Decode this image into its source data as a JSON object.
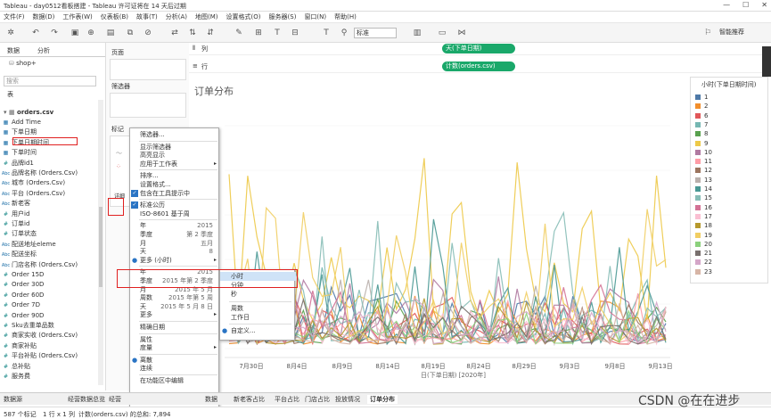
{
  "window": {
    "title": "Tableau - day0512看板搭建 - Tableau 许可证将在 14 天后过期",
    "buttons": [
      "—",
      "☐",
      "✕"
    ]
  },
  "menu": [
    "文件(F)",
    "数据(D)",
    "工作表(W)",
    "仪表板(B)",
    "故事(T)",
    "分析(A)",
    "地图(M)",
    "设置格式(O)",
    "服务器(S)",
    "窗口(N)",
    "帮助(H)"
  ],
  "toolbar": {
    "show_as": "标准",
    "smart": "智能推荐"
  },
  "sidebar": {
    "tab_data": "数据",
    "tab_analysis": "分析",
    "datasource": "shop+",
    "search_placeholder": "搜索",
    "table_header": "表",
    "table_name": "orders.csv",
    "fields": [
      {
        "icon": "dt",
        "name": "Add Time"
      },
      {
        "icon": "dt",
        "name": "下单日期"
      },
      {
        "icon": "dt",
        "name": "下单日期时间"
      },
      {
        "icon": "dt",
        "name": "下单时间"
      },
      {
        "icon": "#",
        "name": "品牌id1"
      },
      {
        "icon": "abc",
        "name": "品牌名称 (Orders.Csv)"
      },
      {
        "icon": "abc",
        "name": "城市 (Orders.Csv)"
      },
      {
        "icon": "abc",
        "name": "平台 (Orders.Csv)"
      },
      {
        "icon": "abc",
        "name": "新老客"
      },
      {
        "icon": "#",
        "name": "用户id"
      },
      {
        "icon": "#",
        "name": "订单id"
      },
      {
        "icon": "#",
        "name": "订单状态"
      },
      {
        "icon": "abc",
        "name": "配送地址eleme"
      },
      {
        "icon": "abc",
        "name": "配送坐标"
      },
      {
        "icon": "abc",
        "name": "门店名称 (Orders.Csv)"
      },
      {
        "icon": "#",
        "name": "Order 15D"
      },
      {
        "icon": "#",
        "name": "Order 30D"
      },
      {
        "icon": "#",
        "name": "Order 60D"
      },
      {
        "icon": "#",
        "name": "Order 7D"
      },
      {
        "icon": "#",
        "name": "Order 90D"
      },
      {
        "icon": "#",
        "name": "Sku去重单品数"
      },
      {
        "icon": "#",
        "name": "商家实收 (Orders.Csv)"
      },
      {
        "icon": "#",
        "name": "商家补贴"
      },
      {
        "icon": "#",
        "name": "平台补贴 (Orders.Csv)"
      },
      {
        "icon": "#",
        "name": "总补贴"
      },
      {
        "icon": "#",
        "name": "服务费"
      }
    ]
  },
  "cards": {
    "pages": "页面",
    "filters": "筛选器",
    "marks": "标记",
    "marks_text": "详细"
  },
  "shelves": {
    "columns_label": "列",
    "columns_pill": "天(下单日期)",
    "rows_label": "行",
    "rows_pill": "计数(orders.csv)"
  },
  "view": {
    "title": "订单分布",
    "x_title": "日(下单日期) [2020年]",
    "x_ticks": [
      "7月30日",
      "8月4日",
      "8月9日",
      "8月14日",
      "8月19日",
      "8月24日",
      "8月29日",
      "9月3日",
      "9月8日",
      "9月13日"
    ]
  },
  "legend": {
    "title": "小时(下单日期时间)",
    "items": [
      "1",
      "2",
      "6",
      "7",
      "8",
      "9",
      "10",
      "11",
      "12",
      "13",
      "14",
      "15",
      "16",
      "17",
      "18",
      "19",
      "20",
      "21",
      "22",
      "23"
    ],
    "colors": [
      "#4e79a7",
      "#f28e2b",
      "#e15759",
      "#76b7b2",
      "#59a14f",
      "#edc948",
      "#b07aa1",
      "#ff9da7",
      "#9c755f",
      "#bab0ac",
      "#499894",
      "#86bcb6",
      "#d37295",
      "#fabfd2",
      "#b6992d",
      "#f1ce63",
      "#8cd17d",
      "#79706e",
      "#d4a6c8",
      "#d7b5a6"
    ]
  },
  "context_menu": {
    "items": [
      {
        "label": "筛选器...",
        "value": "",
        "check": false,
        "arrow": false
      },
      {
        "sep": true
      },
      {
        "label": "显示筛选器",
        "value": "",
        "check": false,
        "arrow": false
      },
      {
        "label": "高亮显示",
        "value": "",
        "check": false,
        "arrow": false
      },
      {
        "label": "应用于工作表",
        "value": "",
        "check": false,
        "arrow": true
      },
      {
        "sep": true
      },
      {
        "label": "排序...",
        "value": "",
        "check": false,
        "arrow": false
      },
      {
        "label": "设置格式...",
        "value": "",
        "check": false,
        "arrow": false
      },
      {
        "label": "包含在工具提示中",
        "value": "",
        "check": true,
        "arrow": false
      },
      {
        "sep": true
      },
      {
        "label": "标准公历",
        "value": "",
        "check": true,
        "arrow": false
      },
      {
        "label": "ISO-8601 基于周",
        "value": "",
        "check": false,
        "arrow": false
      },
      {
        "sep": true
      },
      {
        "label": "年",
        "value": "2015",
        "check": false,
        "arrow": false
      },
      {
        "label": "季度",
        "value": "第 2 季度",
        "check": false,
        "arrow": false
      },
      {
        "label": "月",
        "value": "五月",
        "check": false,
        "arrow": false
      },
      {
        "label": "天",
        "value": "8",
        "check": false,
        "arrow": false
      },
      {
        "label": "更多 (小时)",
        "value": "",
        "check": false,
        "arrow": true,
        "dot": true
      },
      {
        "sep": true
      },
      {
        "label": "年",
        "value": "2015",
        "check": false,
        "arrow": false
      },
      {
        "label": "季度",
        "value": "2015 年第 2 季度",
        "check": false,
        "arrow": false
      },
      {
        "label": "月",
        "value": "2015 年 5 月",
        "check": false,
        "arrow": false
      },
      {
        "label": "周数",
        "value": "2015 年第 5 周",
        "check": false,
        "arrow": false
      },
      {
        "label": "天",
        "value": "2015 年 5 月 8 日",
        "check": false,
        "arrow": false
      },
      {
        "label": "更多",
        "value": "",
        "check": false,
        "arrow": true
      },
      {
        "sep": true
      },
      {
        "label": "精确日期",
        "value": "",
        "check": false,
        "arrow": false
      },
      {
        "sep": true
      },
      {
        "label": "属性",
        "value": "",
        "check": false,
        "arrow": false
      },
      {
        "label": "度量",
        "value": "",
        "check": false,
        "arrow": true
      },
      {
        "sep": true
      },
      {
        "label": "离散",
        "value": "",
        "check": false,
        "arrow": false,
        "dot": true
      },
      {
        "label": "连续",
        "value": "",
        "check": false,
        "arrow": false
      },
      {
        "sep": true
      },
      {
        "label": "在功能区中编辑",
        "value": "",
        "check": false,
        "arrow": false
      }
    ]
  },
  "submenu": {
    "items": [
      {
        "label": "小时",
        "selected": true
      },
      {
        "label": "分钟"
      },
      {
        "label": "秒"
      },
      {
        "sep": true
      },
      {
        "label": "周数"
      },
      {
        "label": "工作日"
      },
      {
        "sep": true
      },
      {
        "label": "自定义...",
        "dot": true
      }
    ]
  },
  "bottom_tabs": [
    "数据源",
    "经营数据总览",
    "经营",
    "数据",
    "新老客占比",
    "平台占比",
    "门店占比",
    "投放情况",
    "订单分布"
  ],
  "status": {
    "marks": "587 个标记",
    "rows": "1 行 x 1 列",
    "sum": "计数(orders.csv) 的总和: 7,894"
  },
  "watermark": "CSDN @在在进步"
}
